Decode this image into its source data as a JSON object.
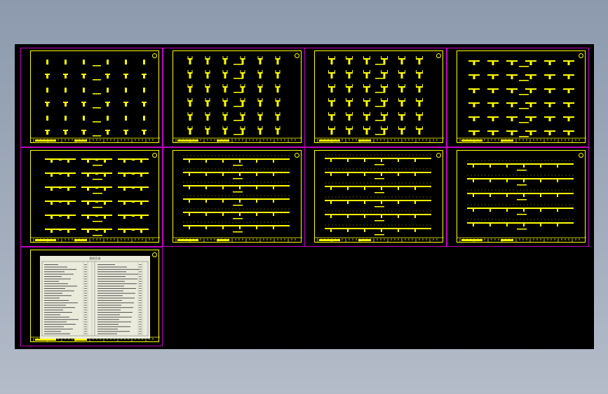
{
  "window": {
    "background": "#000000",
    "frame_color": "#c000c0",
    "drawing_color": "#ffff00"
  },
  "sheets": [
    {
      "name": "sheet-1",
      "type": "pier-columns-grid"
    },
    {
      "name": "sheet-2",
      "type": "pier-caps-grid"
    },
    {
      "name": "sheet-3",
      "type": "pier-caps-wide-grid"
    },
    {
      "name": "sheet-4",
      "type": "t-beams-grid"
    },
    {
      "name": "sheet-5",
      "type": "double-beams-grid"
    },
    {
      "name": "sheet-6",
      "type": "girder-rows"
    },
    {
      "name": "sheet-7",
      "type": "girder-rows-long"
    },
    {
      "name": "sheet-8",
      "type": "girder-rows-sparse"
    },
    {
      "name": "sheet-9",
      "type": "drawing-index-table"
    }
  ],
  "index_sheet": {
    "title": "图纸目录"
  }
}
